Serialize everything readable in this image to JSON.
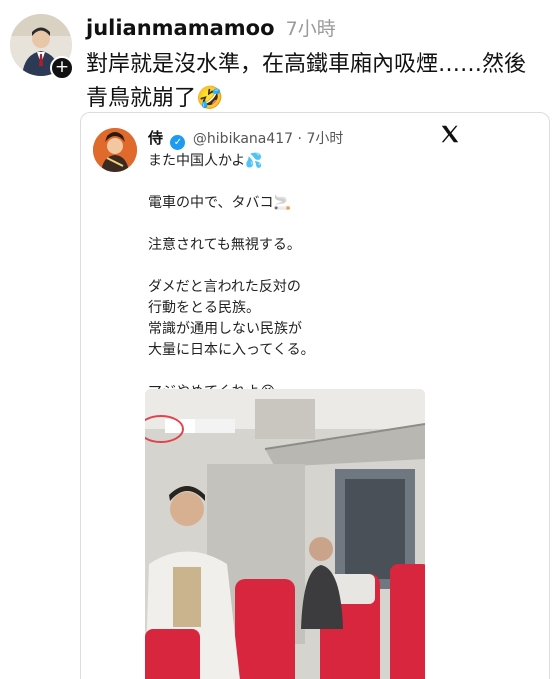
{
  "post": {
    "username": "julianmamamoo",
    "time": "7小時",
    "text": "對岸就是沒水準，在高鐵車廂內吸煙……然後青鳥就崩了🤣"
  },
  "quoted": {
    "name": "侍",
    "handle": "@hibikana417",
    "time": "7小时",
    "paragraphs": [
      "また中国人かよ💦",
      "電車の中で、タバコ🚬",
      "注意されても無視する。",
      "ダメだと言われた反対の\n行動をとる民族。\n常識が通用しない民族が\n大量に日本に入ってくる。",
      "マジやめてくれよ😭"
    ]
  },
  "icons": {
    "follow": "plus-icon",
    "verified": "verified-check-icon",
    "platform": "x-logo-icon"
  },
  "colors": {
    "verified": "#1d9bf0",
    "seat_red": "#d7263d",
    "circle_highlight": "#e0454f"
  }
}
